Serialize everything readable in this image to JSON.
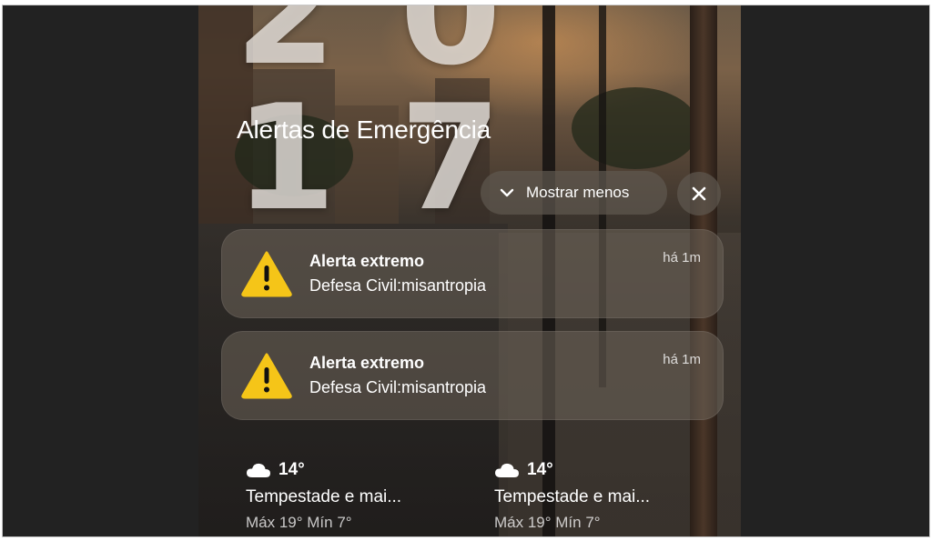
{
  "lockscreen": {
    "clock": "20 17",
    "section_title": "Alertas de Emergência",
    "show_less_label": "Mostrar menos"
  },
  "notifications": [
    {
      "title": "Alerta extremo",
      "body": "Defesa Civil:misantropia",
      "time": "há 1m"
    },
    {
      "title": "Alerta extremo",
      "body": "Defesa Civil:misantropia",
      "time": "há 1m"
    }
  ],
  "widgets": [
    {
      "temp": "14°",
      "condition": "Tempestade e mai...",
      "range": "Máx 19° Mín 7°",
      "icon": "cloud-icon"
    },
    {
      "temp": "14°",
      "condition": "Tempestade e mai...",
      "range": "Máx 19° Mín 7°",
      "icon": "cloud-icon"
    }
  ],
  "colors": {
    "warning": "#f5c518",
    "frame_bg": "#222222"
  }
}
